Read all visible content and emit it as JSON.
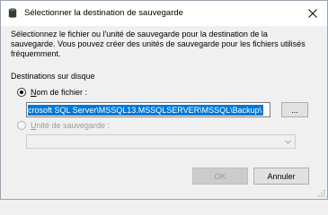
{
  "window": {
    "title": "Sélectionner la destination de sauvegarde",
    "icons": {
      "title": "database-icon",
      "close": "close-icon"
    }
  },
  "description": "Sélectionnez le fichier ou l'unité de sauvegarde pour la destination de la sauvegarde. Vous pouvez créer des unités de sauvegarde pour les fichiers utilisés fréquemment.",
  "destinations": {
    "group_label": "Destinations sur disque",
    "file_name": {
      "label": "Nom de fichier :",
      "selected": true,
      "value": "crosoft SQL Server\\MSSQL13.MSSQLSERVER\\MSSQL\\Backup\\",
      "browse_label": "..."
    },
    "backup_device": {
      "label": "Unité de sauvegarde :",
      "selected": false,
      "enabled": false,
      "value": ""
    }
  },
  "buttons": {
    "ok": "OK",
    "cancel": "Annuler",
    "ok_enabled": false
  },
  "colors": {
    "selection": "#0078d7",
    "window_bg": "#f0f0f0",
    "titlebar_bg": "#ffffff"
  }
}
